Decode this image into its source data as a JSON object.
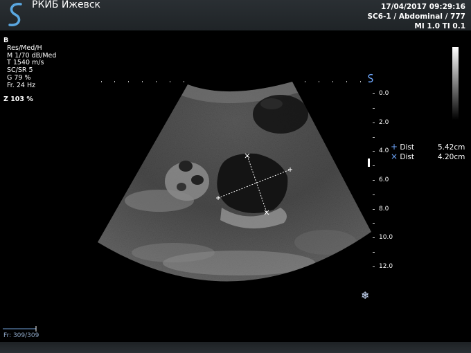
{
  "header": {
    "clinic_name": "РКИБ Ижевск",
    "datetime": "17/04/2017 09:29:16",
    "probe_preset": "SC6-1 / Abdominal / 777",
    "indices": "MI 1.0  TI 0.1"
  },
  "params": {
    "mode": "B",
    "lines": [
      "Res/Med/H",
      "M 1/70 dB/Med",
      "T 1540 m/s",
      "SC/SR 5",
      "G 79 %",
      "Fr. 24 Hz"
    ],
    "zoom": "Z  103  %"
  },
  "depth_scale": {
    "labels": [
      "0.0",
      "2.0",
      "4.0",
      "6.0",
      "8.0",
      "10.0",
      "12.0"
    ],
    "unit": "cm"
  },
  "measurements": [
    {
      "symbol": "+",
      "label": "Dist",
      "value": "5.42",
      "unit": "cm"
    },
    {
      "symbol": "×",
      "label": "Dist",
      "value": "4.20",
      "unit": "cm"
    }
  ],
  "status": {
    "frame_counter": "Fr: 309/309",
    "freeze_icon": "snowflake-icon"
  },
  "colors": {
    "header_bg": "#23282b",
    "marker_blue": "#6fa8ff",
    "logo_blue": "#5aa7e0"
  }
}
